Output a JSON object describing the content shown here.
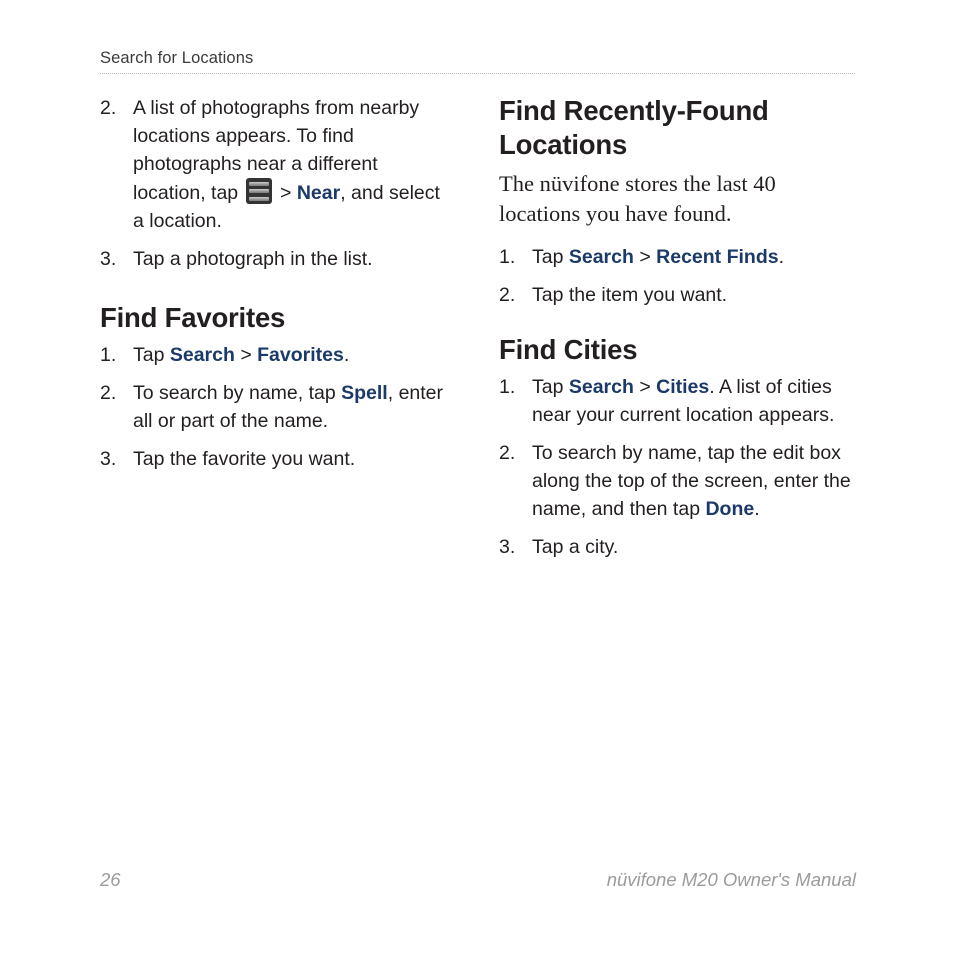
{
  "document": {
    "running_header": "Search for Locations",
    "page_number": "26",
    "manual_title": "nüvifone M20 Owner's Manual"
  },
  "left_column": {
    "continued_list": {
      "items": [
        {
          "num": "2.",
          "parts": [
            {
              "t": "text",
              "v": "A list of photographs from nearby locations appears. To find photographs near a different location, tap "
            },
            {
              "t": "icon",
              "v": "menu-icon"
            },
            {
              "t": "sep",
              "v": " > "
            },
            {
              "t": "ui",
              "v": "Near"
            },
            {
              "t": "text",
              "v": ", and select a location."
            }
          ],
          "plain": "A list of photographs from nearby locations appears. To find photographs near a different location, tap  > Near, and select a location."
        },
        {
          "num": "3.",
          "parts": [
            {
              "t": "text",
              "v": "Tap a photograph in the list."
            }
          ],
          "plain": "Tap a photograph in the list."
        }
      ]
    },
    "section": {
      "heading": "Find Favorites",
      "items": [
        {
          "num": "1.",
          "parts": [
            {
              "t": "text",
              "v": "Tap "
            },
            {
              "t": "ui",
              "v": "Search"
            },
            {
              "t": "sep",
              "v": " > "
            },
            {
              "t": "ui",
              "v": "Favorites"
            },
            {
              "t": "text",
              "v": "."
            }
          ],
          "plain": "Tap Search > Favorites."
        },
        {
          "num": "2.",
          "parts": [
            {
              "t": "text",
              "v": "To search by name, tap "
            },
            {
              "t": "ui",
              "v": "Spell"
            },
            {
              "t": "text",
              "v": ", enter all or part of the name."
            }
          ],
          "plain": "To search by name, tap Spell, enter all or part of the name."
        },
        {
          "num": "3.",
          "parts": [
            {
              "t": "text",
              "v": "Tap the favorite you want."
            }
          ],
          "plain": "Tap the favorite you want."
        }
      ]
    }
  },
  "right_column": {
    "section_recent": {
      "heading": "Find Recently-Found Locations",
      "intro": "The nüvifone stores the last 40 locations you have found.",
      "items": [
        {
          "num": "1.",
          "parts": [
            {
              "t": "text",
              "v": "Tap "
            },
            {
              "t": "ui",
              "v": "Search"
            },
            {
              "t": "sep",
              "v": " > "
            },
            {
              "t": "ui",
              "v": "Recent Finds"
            },
            {
              "t": "text",
              "v": "."
            }
          ],
          "plain": "Tap Search > Recent Finds."
        },
        {
          "num": "2.",
          "parts": [
            {
              "t": "text",
              "v": "Tap the item you want."
            }
          ],
          "plain": "Tap the item you want."
        }
      ]
    },
    "section_cities": {
      "heading": "Find Cities",
      "items": [
        {
          "num": "1.",
          "parts": [
            {
              "t": "text",
              "v": "Tap "
            },
            {
              "t": "ui",
              "v": "Search"
            },
            {
              "t": "sep",
              "v": " > "
            },
            {
              "t": "ui",
              "v": "Cities"
            },
            {
              "t": "text",
              "v": ". A list of cities near your current location appears."
            }
          ],
          "plain": "Tap Search > Cities. A list of cities near your current location appears."
        },
        {
          "num": "2.",
          "parts": [
            {
              "t": "text",
              "v": "To search by name, tap the edit box along the top of the screen, enter the name, and then tap "
            },
            {
              "t": "ui",
              "v": "Done"
            },
            {
              "t": "text",
              "v": "."
            }
          ],
          "plain": "To search by name, tap the edit box along the top of the screen, enter the name, and then tap Done."
        },
        {
          "num": "3.",
          "parts": [
            {
              "t": "text",
              "v": "Tap a city."
            }
          ],
          "plain": "Tap a city."
        }
      ]
    }
  },
  "colors": {
    "ui_term_blue": "#1b3a69",
    "body_text": "#231f20",
    "footer_gray": "#9b9b9b",
    "rule_gray": "#b9b9b9",
    "icon_dark": "#343434",
    "icon_bar": "#9a9a9a"
  }
}
